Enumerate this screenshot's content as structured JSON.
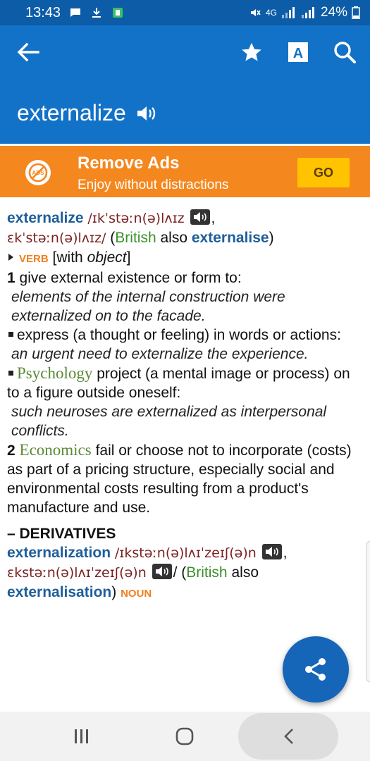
{
  "status_bar": {
    "time": "13:43",
    "network": "4G",
    "battery": "24%"
  },
  "app_bar": {
    "headword": "externalize"
  },
  "ads": {
    "title": "Remove Ads",
    "subtitle": "Enjoy without distractions",
    "button": "GO",
    "icon_text": "ADS"
  },
  "entry": {
    "headword": "externalize",
    "pron1": "/ɪkˈstəːn(ə)lʌɪz",
    "comma1": ",",
    "pron2": "ɛkˈstəːn(ə)lʌɪz/",
    "paren_open": "(",
    "british": "British",
    "also1": "also",
    "variant": "externalise",
    "paren_close": ")",
    "pos": "verb",
    "grammar_open": "[with",
    "grammar_obj": "object",
    "grammar_close": "]",
    "sense1_num": "1",
    "sense1_def": "give external existence or form to:",
    "sense1_ex": "elements of the internal construction were externalized on to the facade.",
    "sub1_def": "express (a thought or feeling) in words or actions:",
    "sub1_ex": "an urgent need to externalize the experience.",
    "sub2_domain": "Psychology",
    "sub2_def": "project (a mental image or process) on to a figure outside oneself:",
    "sub2_ex": "such neuroses are externalized as interpersonal conflicts.",
    "sense2_num": "2",
    "sense2_domain": "Economics",
    "sense2_def": "fail or choose not to incorporate (costs) as part of a pricing structure, especially social and environmental costs resulting from a product's manufacture and use.",
    "derivatives_head": "– DERIVATIVES",
    "deriv_word": "externalization",
    "deriv_pron1": "/ɪkstəːn(ə)lʌɪˈzeɪʃ(ə)n",
    "deriv_comma": ",",
    "deriv_pron2": "ɛkstəːn(ə)lʌɪˈzeɪʃ(ə)n",
    "deriv_slash": "/ (",
    "deriv_british": "British",
    "deriv_also": "also",
    "deriv_variant": "externalisation",
    "deriv_paren_close": ")",
    "deriv_pos": "noun"
  },
  "icons": {
    "back": "back-arrow-icon",
    "favorite": "star-icon",
    "font_size": "font-size-icon",
    "search": "search-icon",
    "speaker": "speaker-icon",
    "share": "share-icon"
  },
  "colors": {
    "app_bar": "#1272c8",
    "status_bar": "#0d5ca8",
    "ads_banner": "#f5871f",
    "go_button": "#ffc300",
    "headword": "#1f5e9b",
    "pos": "#f08020",
    "region": "#3d8f2a",
    "fab": "#1565b8"
  }
}
